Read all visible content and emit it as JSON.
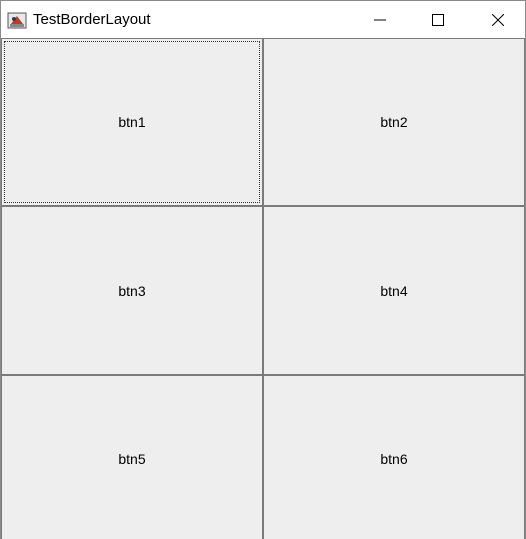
{
  "window": {
    "title": "TestBorderLayout",
    "icon": "java-cup-icon",
    "controls": [
      "minimize-icon",
      "maximize-icon",
      "close-icon"
    ]
  },
  "buttons": [
    {
      "label": "btn1",
      "focused": true
    },
    {
      "label": "btn2",
      "focused": false
    },
    {
      "label": "btn3",
      "focused": false
    },
    {
      "label": "btn4",
      "focused": false
    },
    {
      "label": "btn5",
      "focused": false
    },
    {
      "label": "btn6",
      "focused": false
    }
  ],
  "colors": {
    "button_face": "#eeeeee",
    "button_border": "#7a7a7a",
    "titlebar": "#ffffff"
  }
}
